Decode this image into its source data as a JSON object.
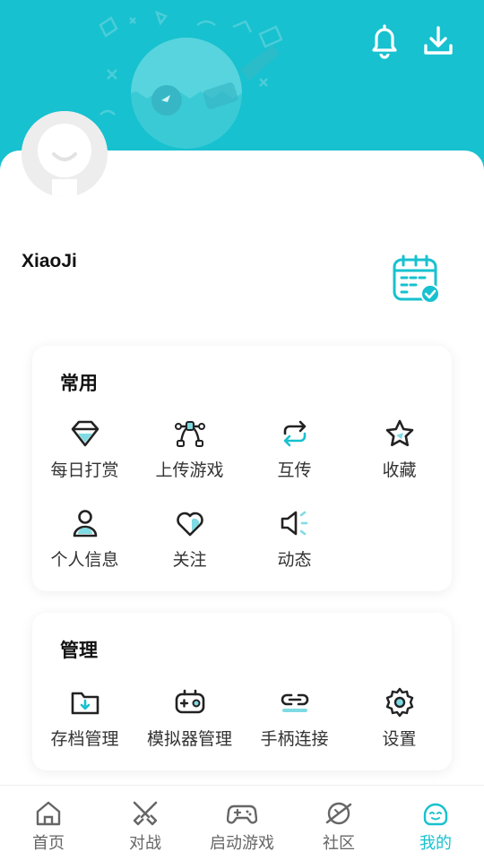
{
  "colors": {
    "accent": "#17c1cf",
    "text": "#111111",
    "label": "#333333",
    "inactive": "#666666"
  },
  "header": {
    "icons": [
      "bell-icon",
      "download-icon"
    ]
  },
  "profile": {
    "username": "XiaoJi",
    "checkin_icon": "calendar-check-icon"
  },
  "sections": {
    "common": {
      "title": "常用",
      "items": [
        {
          "label": "每日打赏",
          "icon": "diamond-icon"
        },
        {
          "label": "上传游戏",
          "icon": "upload-nodes-icon"
        },
        {
          "label": "互传",
          "icon": "sync-arrows-icon"
        },
        {
          "label": "收藏",
          "icon": "star-icon"
        },
        {
          "label": "个人信息",
          "icon": "user-icon"
        },
        {
          "label": "关注",
          "icon": "heart-icon"
        },
        {
          "label": "动态",
          "icon": "speaker-icon"
        }
      ]
    },
    "manage": {
      "title": "管理",
      "items": [
        {
          "label": "存档管理",
          "icon": "folder-icon"
        },
        {
          "label": "模拟器管理",
          "icon": "emulator-icon"
        },
        {
          "label": "手柄连接",
          "icon": "link-icon"
        },
        {
          "label": "设置",
          "icon": "settings-gear-icon"
        }
      ]
    }
  },
  "nav": {
    "active": "我的",
    "items": [
      {
        "label": "首页",
        "icon": "home-icon"
      },
      {
        "label": "对战",
        "icon": "swords-icon"
      },
      {
        "label": "启动游戏",
        "icon": "gamepad-icon"
      },
      {
        "label": "社区",
        "icon": "planet-icon"
      },
      {
        "label": "我的",
        "icon": "face-icon"
      }
    ]
  }
}
